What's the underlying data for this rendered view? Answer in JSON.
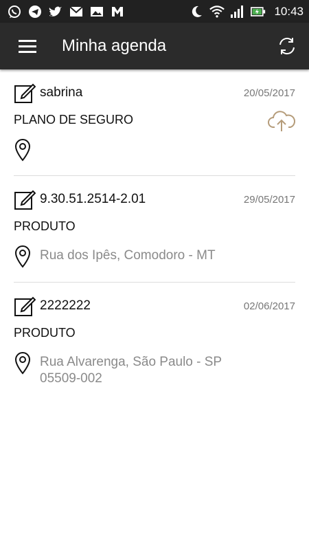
{
  "status_bar": {
    "time": "10:43",
    "icons": [
      "whatsapp-icon",
      "telegram-icon",
      "twitter-icon",
      "gmail-icon",
      "image-icon",
      "app-m-icon",
      "do-not-disturb-moon-icon",
      "wifi-icon",
      "signal-icon",
      "battery-charging-icon"
    ]
  },
  "app_bar": {
    "title": "Minha agenda",
    "menu_icon": "menu-icon",
    "sync_icon": "sync-icon"
  },
  "appointments": [
    {
      "title": "sabrina",
      "date": "20/05/2017",
      "type": "PLANO DE SEGURO",
      "address_line1": "",
      "address_line2": "",
      "has_upload": true
    },
    {
      "title": "9.30.51.2514-2.01",
      "date": "29/05/2017",
      "type": "PRODUTO",
      "address_line1": "Rua dos Ipês, Comodoro - MT",
      "address_line2": "",
      "has_upload": false
    },
    {
      "title": "2222222",
      "date": "02/06/2017",
      "type": "PRODUTO",
      "address_line1": "Rua Alvarenga, São Paulo - SP",
      "address_line2": "05509-002",
      "has_upload": false
    }
  ],
  "colors": {
    "app_bar": "#2b2b2b",
    "status_bar": "#212121",
    "upload_icon": "#b59c7a",
    "muted_text": "#8a8a8a",
    "date_text": "#777777"
  }
}
